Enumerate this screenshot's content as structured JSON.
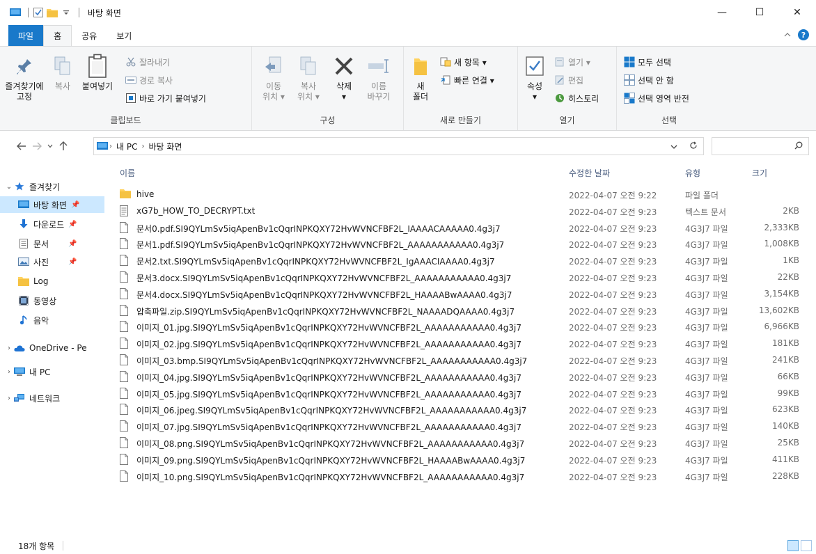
{
  "window": {
    "title": "바탕 화면",
    "minimize_glyph": "—",
    "maximize_glyph": "☐",
    "close_glyph": "✕"
  },
  "tabs": {
    "file": "파일",
    "home": "홈",
    "share": "공유",
    "view": "보기"
  },
  "ribbon": {
    "clipboard": {
      "label": "클립보드",
      "pin": "즐겨찾기에\n고정",
      "pin_line1": "즐겨찾기에",
      "pin_line2": "고정",
      "copy": "복사",
      "paste": "붙여넣기",
      "cut": "잘라내기",
      "copy_path": "경로 복사",
      "paste_shortcut": "바로 가기 붙여넣기"
    },
    "organize": {
      "label": "구성",
      "move_line1": "이동",
      "move_line2": "위치 ▾",
      "copy_line1": "복사",
      "copy_line2": "위치 ▾",
      "delete": "삭제",
      "delete_arrow": "▾",
      "rename_line1": "이름",
      "rename_line2": "바꾸기"
    },
    "new": {
      "label": "새로 만들기",
      "folder_line1": "새",
      "folder_line2": "폴더",
      "new_item": "새 항목 ▾",
      "easy_access": "빠른 연결 ▾"
    },
    "open": {
      "label": "열기",
      "properties": "속성",
      "properties_arrow": "▾",
      "open": "열기 ▾",
      "edit": "편집",
      "history": "히스토리"
    },
    "select": {
      "label": "선택",
      "select_all": "모두 선택",
      "select_none": "선택 안 함",
      "invert": "선택 영역 반전"
    }
  },
  "address": {
    "crumbs": [
      "내 PC",
      "바탕 화면"
    ],
    "search_placeholder": ""
  },
  "navpane": {
    "quick_access": "즐겨찾기",
    "items": [
      {
        "label": "바탕 화면",
        "icon": "desktop-icon"
      },
      {
        "label": "다운로드",
        "icon": "download-icon"
      },
      {
        "label": "문서",
        "icon": "document-icon"
      },
      {
        "label": "사진",
        "icon": "picture-icon"
      },
      {
        "label": "Log",
        "icon": "folder-icon"
      },
      {
        "label": "동영상",
        "icon": "video-icon"
      },
      {
        "label": "음악",
        "icon": "music-icon"
      }
    ],
    "onedrive": "OneDrive - Pe",
    "this_pc": "내 PC",
    "network": "네트워크"
  },
  "columns": {
    "name": "이름",
    "date": "수정한 날짜",
    "type": "유형",
    "size": "크기"
  },
  "files": [
    {
      "name": "hive",
      "date": "2022-04-07 오전 9:22",
      "type": "파일 폴더",
      "size": "",
      "icon": "folder"
    },
    {
      "name": "xG7b_HOW_TO_DECRYPT.txt",
      "date": "2022-04-07 오전 9:23",
      "type": "텍스트 문서",
      "size": "2KB",
      "icon": "text"
    },
    {
      "name": "문서0.pdf.SI9QYLmSv5iqApenBv1cQqrINPKQXY72HvWVNCFBF2L_IAAAACAAAAA0.4g3j7",
      "date": "2022-04-07 오전 9:23",
      "type": "4G3J7 파일",
      "size": "2,333KB",
      "icon": "file"
    },
    {
      "name": "문서1.pdf.SI9QYLmSv5iqApenBv1cQqrINPKQXY72HvWVNCFBF2L_AAAAAAAAAAA0.4g3j7",
      "date": "2022-04-07 오전 9:23",
      "type": "4G3J7 파일",
      "size": "1,008KB",
      "icon": "file"
    },
    {
      "name": "문서2.txt.SI9QYLmSv5iqApenBv1cQqrINPKQXY72HvWVNCFBF2L_IgAAACIAAAA0.4g3j7",
      "date": "2022-04-07 오전 9:23",
      "type": "4G3J7 파일",
      "size": "1KB",
      "icon": "file"
    },
    {
      "name": "문서3.docx.SI9QYLmSv5iqApenBv1cQqrINPKQXY72HvWVNCFBF2L_AAAAAAAAAAA0.4g3j7",
      "date": "2022-04-07 오전 9:23",
      "type": "4G3J7 파일",
      "size": "22KB",
      "icon": "file"
    },
    {
      "name": "문서4.docx.SI9QYLmSv5iqApenBv1cQqrINPKQXY72HvWVNCFBF2L_HAAAABwAAAA0.4g3j7",
      "date": "2022-04-07 오전 9:23",
      "type": "4G3J7 파일",
      "size": "3,154KB",
      "icon": "file"
    },
    {
      "name": "압축파일.zip.SI9QYLmSv5iqApenBv1cQqrINPKQXY72HvWVNCFBF2L_NAAAADQAAAA0.4g3j7",
      "date": "2022-04-07 오전 9:23",
      "type": "4G3J7 파일",
      "size": "13,602KB",
      "icon": "file"
    },
    {
      "name": "이미지_01.jpg.SI9QYLmSv5iqApenBv1cQqrINPKQXY72HvWVNCFBF2L_AAAAAAAAAAA0.4g3j7",
      "date": "2022-04-07 오전 9:23",
      "type": "4G3J7 파일",
      "size": "6,966KB",
      "icon": "file"
    },
    {
      "name": "이미지_02.jpg.SI9QYLmSv5iqApenBv1cQqrINPKQXY72HvWVNCFBF2L_AAAAAAAAAAA0.4g3j7",
      "date": "2022-04-07 오전 9:23",
      "type": "4G3J7 파일",
      "size": "181KB",
      "icon": "file"
    },
    {
      "name": "이미지_03.bmp.SI9QYLmSv5iqApenBv1cQqrINPKQXY72HvWVNCFBF2L_AAAAAAAAAAA0.4g3j7",
      "date": "2022-04-07 오전 9:23",
      "type": "4G3J7 파일",
      "size": "241KB",
      "icon": "file"
    },
    {
      "name": "이미지_04.jpg.SI9QYLmSv5iqApenBv1cQqrINPKQXY72HvWVNCFBF2L_AAAAAAAAAAA0.4g3j7",
      "date": "2022-04-07 오전 9:23",
      "type": "4G3J7 파일",
      "size": "66KB",
      "icon": "file"
    },
    {
      "name": "이미지_05.jpg.SI9QYLmSv5iqApenBv1cQqrINPKQXY72HvWVNCFBF2L_AAAAAAAAAAA0.4g3j7",
      "date": "2022-04-07 오전 9:23",
      "type": "4G3J7 파일",
      "size": "99KB",
      "icon": "file"
    },
    {
      "name": "이미지_06.jpeg.SI9QYLmSv5iqApenBv1cQqrINPKQXY72HvWVNCFBF2L_AAAAAAAAAAA0.4g3j7",
      "date": "2022-04-07 오전 9:23",
      "type": "4G3J7 파일",
      "size": "623KB",
      "icon": "file"
    },
    {
      "name": "이미지_07.jpg.SI9QYLmSv5iqApenBv1cQqrINPKQXY72HvWVNCFBF2L_AAAAAAAAAAA0.4g3j7",
      "date": "2022-04-07 오전 9:23",
      "type": "4G3J7 파일",
      "size": "140KB",
      "icon": "file"
    },
    {
      "name": "이미지_08.png.SI9QYLmSv5iqApenBv1cQqrINPKQXY72HvWVNCFBF2L_AAAAAAAAAAA0.4g3j7",
      "date": "2022-04-07 오전 9:23",
      "type": "4G3J7 파일",
      "size": "25KB",
      "icon": "file"
    },
    {
      "name": "이미지_09.png.SI9QYLmSv5iqApenBv1cQqrINPKQXY72HvWVNCFBF2L_HAAAABwAAAA0.4g3j7",
      "date": "2022-04-07 오전 9:23",
      "type": "4G3J7 파일",
      "size": "411KB",
      "icon": "file"
    },
    {
      "name": "이미지_10.png.SI9QYLmSv5iqApenBv1cQqrINPKQXY72HvWVNCFBF2L_AAAAAAAAAAA0.4g3j7",
      "date": "2022-04-07 오전 9:23",
      "type": "4G3J7 파일",
      "size": "228KB",
      "icon": "file"
    }
  ],
  "status": {
    "count": "18개 항목"
  },
  "colors": {
    "accent": "#1979ca",
    "selection": "#cce8ff",
    "folder": "#ffd25e"
  }
}
